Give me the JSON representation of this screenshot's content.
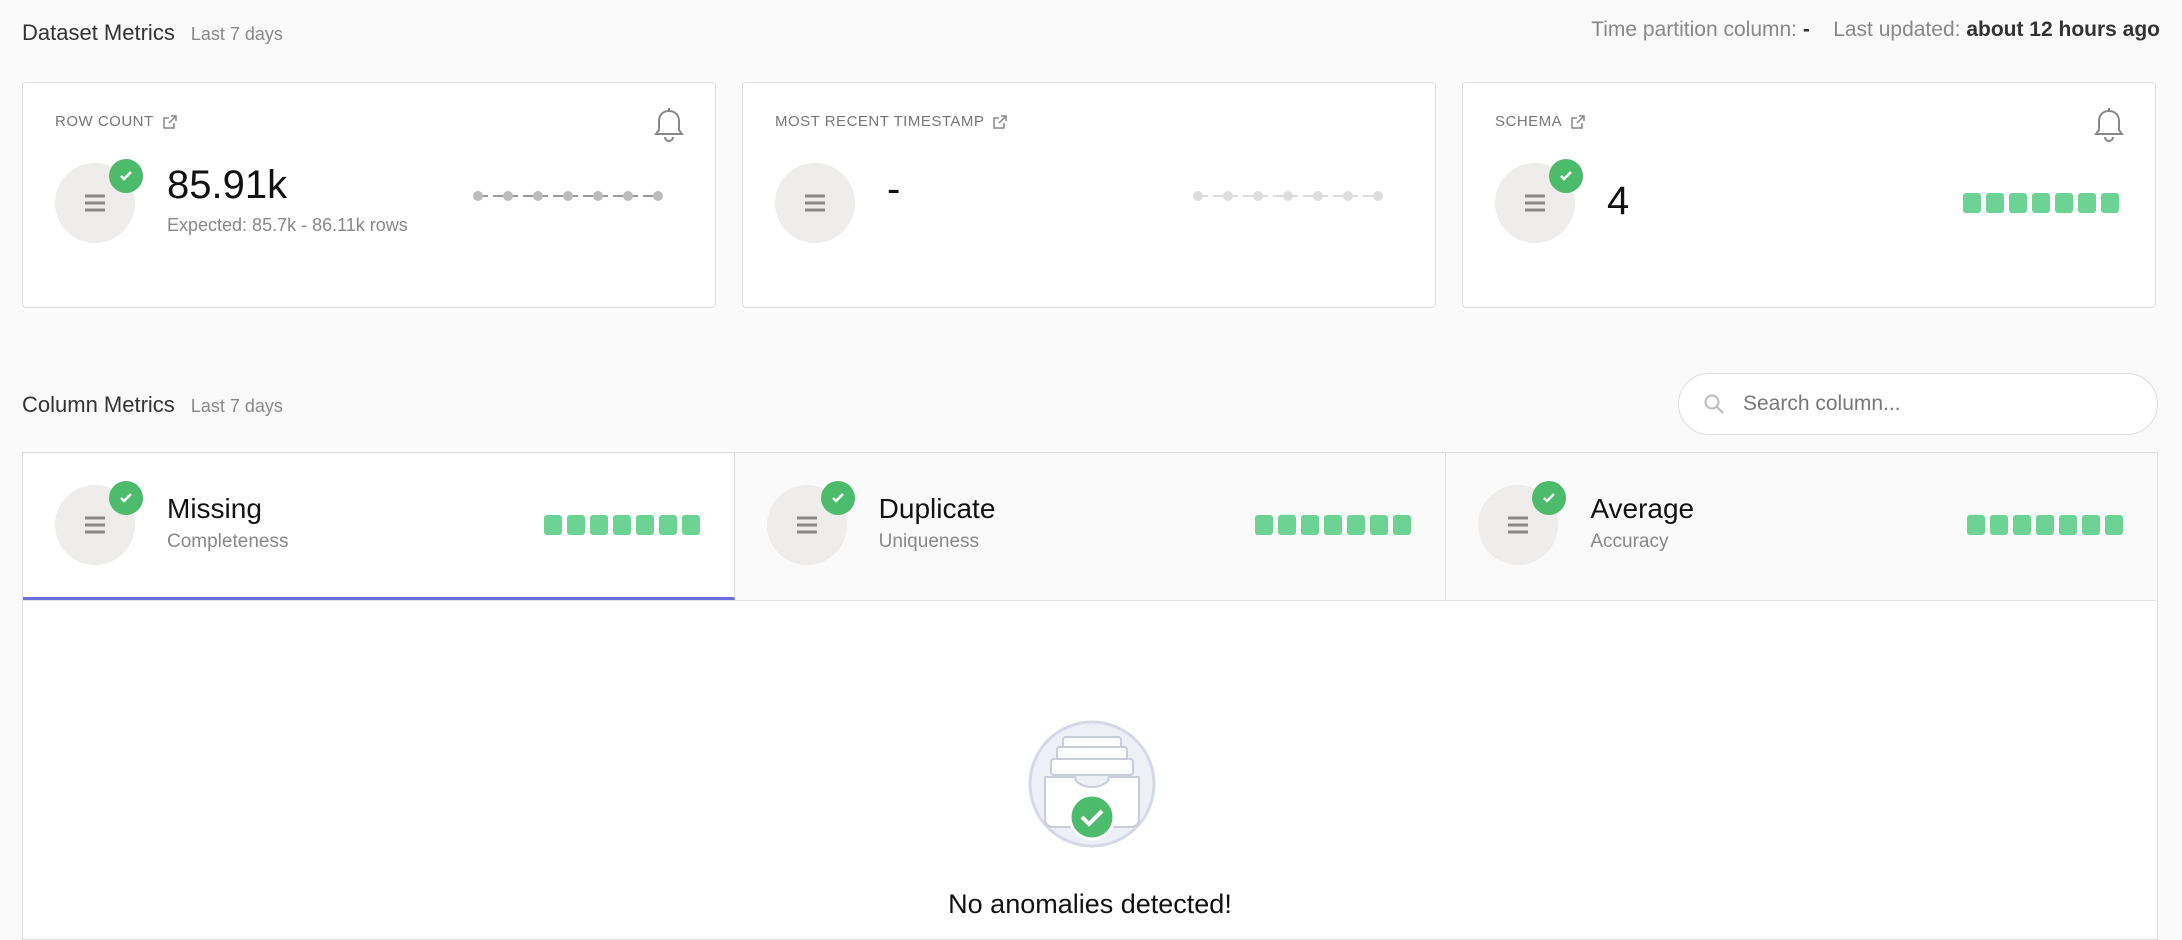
{
  "dataset": {
    "title": "Dataset Metrics",
    "range": "Last 7 days",
    "partition_label": "Time partition column:",
    "partition_value": "-",
    "updated_label": "Last updated:",
    "updated_value": "about 12 hours ago"
  },
  "cards": [
    {
      "label": "ROW COUNT",
      "value": "85.91k",
      "sub": "Expected: 85.7k - 86.11k rows",
      "status": "ok",
      "has_bell": true,
      "trend": "sparkline"
    },
    {
      "label": "MOST RECENT TIMESTAMP",
      "value": "-",
      "sub": "",
      "status": "none",
      "has_bell": false,
      "trend": "sparkline-faded"
    },
    {
      "label": "SCHEMA",
      "value": "4",
      "sub": "",
      "status": "ok",
      "has_bell": true,
      "trend": "squares",
      "days": 7
    }
  ],
  "columns": {
    "title": "Column Metrics",
    "range": "Last 7 days",
    "search_placeholder": "Search column..."
  },
  "tabs": [
    {
      "title": "Missing",
      "sub": "Completeness",
      "active": true,
      "days": 7
    },
    {
      "title": "Duplicate",
      "sub": "Uniqueness",
      "active": false,
      "days": 7
    },
    {
      "title": "Average",
      "sub": "Accuracy",
      "active": false,
      "days": 7
    }
  ],
  "empty_state": {
    "message": "No anomalies detected!"
  },
  "icons": {
    "external": "external-link-icon",
    "bell": "bell-icon",
    "metric": "list-icon",
    "check": "check-icon",
    "search": "search-icon",
    "empty": "inbox-check-icon"
  },
  "colors": {
    "ok": "#4cbb6b",
    "square": "#6cd394",
    "active_tab": "#6b6fe0"
  }
}
